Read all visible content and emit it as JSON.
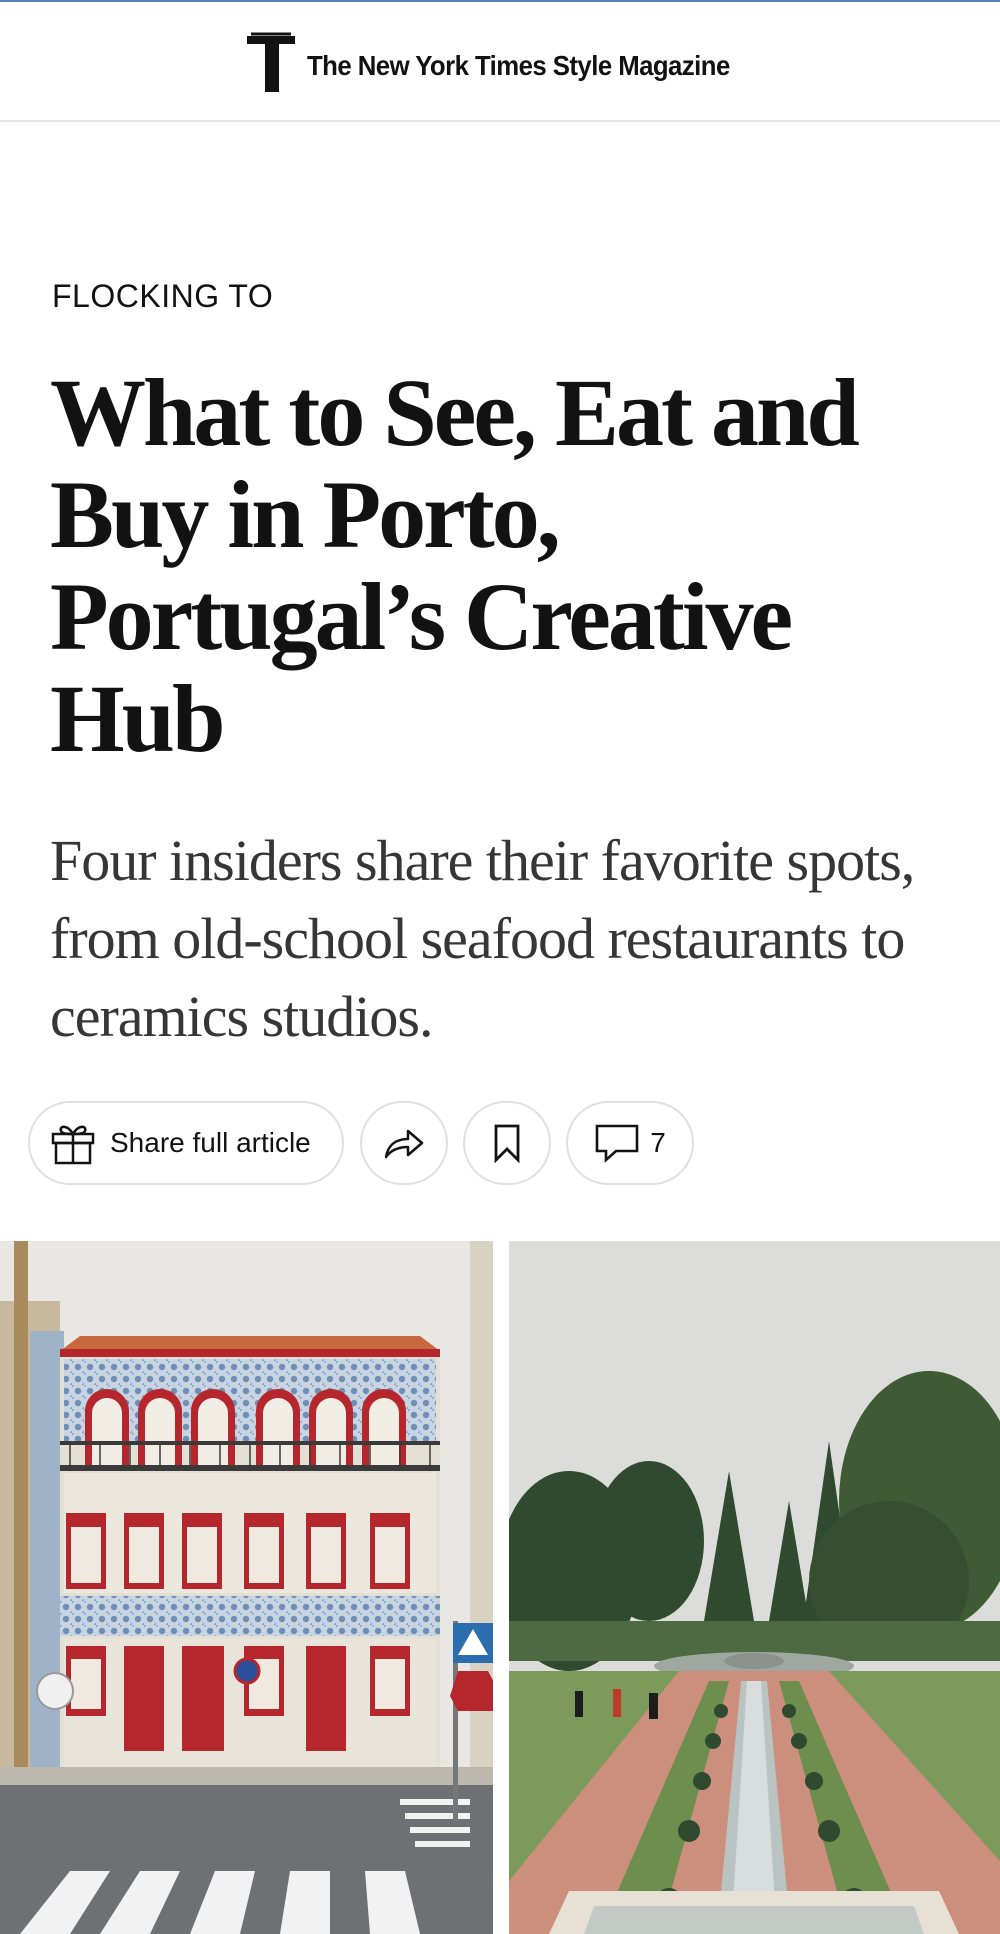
{
  "masthead": {
    "logo_icon": "t-magazine-logo-icon",
    "title": "The New York Times Style Magazine"
  },
  "article": {
    "kicker": "FLOCKING TO",
    "headline": "What to See, Eat and Buy in Porto, Portugal’s Creative Hub",
    "summary": "Four insiders share their favorite spots, from old-school seafood restaurants to ceramics studios."
  },
  "actions": {
    "share_full_label": "Share full article",
    "share_full_icon": "gift-icon",
    "share_icon": "share-arrow-icon",
    "save_icon": "bookmark-icon",
    "comments_icon": "comment-icon",
    "comments_count": "7"
  },
  "images": [
    {
      "name": "porto-tiled-building-photo"
    },
    {
      "name": "porto-garden-fountain-photo"
    }
  ],
  "colors": {
    "text": "#121212",
    "summary_text": "#363636",
    "button_border": "#dfdfdf",
    "divider": "#e2e2e2",
    "facade_red": "#b5272c",
    "tile_blue": "#6f8fb5"
  }
}
